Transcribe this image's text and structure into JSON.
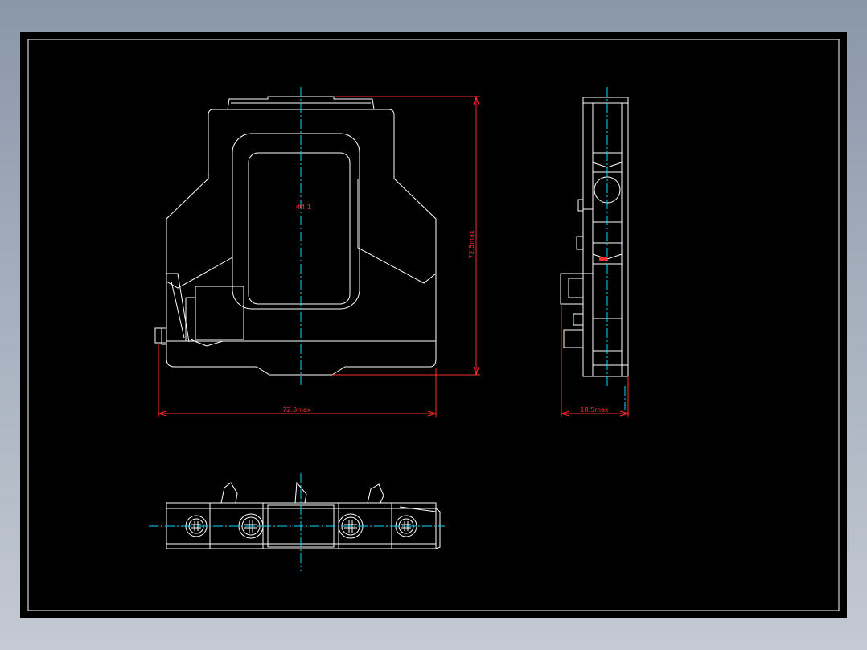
{
  "drawing": {
    "colors": {
      "background": "#000000",
      "lines": "#ffffff",
      "centerlines": "#00d8ff",
      "dimensions": "#ff2a2a"
    },
    "dimensions": {
      "width": "72.8max",
      "height": "72.5max",
      "depth": "18.5max",
      "center_mark": "Φ4.1"
    }
  }
}
